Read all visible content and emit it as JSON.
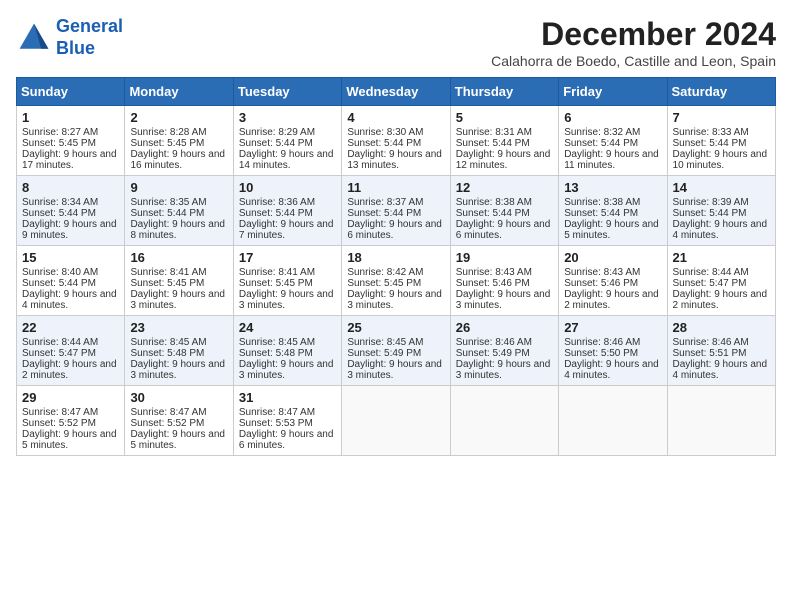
{
  "logo": {
    "line1": "General",
    "line2": "Blue"
  },
  "title": "December 2024",
  "subtitle": "Calahorra de Boedo, Castille and Leon, Spain",
  "days_of_week": [
    "Sunday",
    "Monday",
    "Tuesday",
    "Wednesday",
    "Thursday",
    "Friday",
    "Saturday"
  ],
  "weeks": [
    [
      {
        "day": "1",
        "sunrise": "Sunrise: 8:27 AM",
        "sunset": "Sunset: 5:45 PM",
        "daylight": "Daylight: 9 hours and 17 minutes."
      },
      {
        "day": "2",
        "sunrise": "Sunrise: 8:28 AM",
        "sunset": "Sunset: 5:45 PM",
        "daylight": "Daylight: 9 hours and 16 minutes."
      },
      {
        "day": "3",
        "sunrise": "Sunrise: 8:29 AM",
        "sunset": "Sunset: 5:44 PM",
        "daylight": "Daylight: 9 hours and 14 minutes."
      },
      {
        "day": "4",
        "sunrise": "Sunrise: 8:30 AM",
        "sunset": "Sunset: 5:44 PM",
        "daylight": "Daylight: 9 hours and 13 minutes."
      },
      {
        "day": "5",
        "sunrise": "Sunrise: 8:31 AM",
        "sunset": "Sunset: 5:44 PM",
        "daylight": "Daylight: 9 hours and 12 minutes."
      },
      {
        "day": "6",
        "sunrise": "Sunrise: 8:32 AM",
        "sunset": "Sunset: 5:44 PM",
        "daylight": "Daylight: 9 hours and 11 minutes."
      },
      {
        "day": "7",
        "sunrise": "Sunrise: 8:33 AM",
        "sunset": "Sunset: 5:44 PM",
        "daylight": "Daylight: 9 hours and 10 minutes."
      }
    ],
    [
      {
        "day": "8",
        "sunrise": "Sunrise: 8:34 AM",
        "sunset": "Sunset: 5:44 PM",
        "daylight": "Daylight: 9 hours and 9 minutes."
      },
      {
        "day": "9",
        "sunrise": "Sunrise: 8:35 AM",
        "sunset": "Sunset: 5:44 PM",
        "daylight": "Daylight: 9 hours and 8 minutes."
      },
      {
        "day": "10",
        "sunrise": "Sunrise: 8:36 AM",
        "sunset": "Sunset: 5:44 PM",
        "daylight": "Daylight: 9 hours and 7 minutes."
      },
      {
        "day": "11",
        "sunrise": "Sunrise: 8:37 AM",
        "sunset": "Sunset: 5:44 PM",
        "daylight": "Daylight: 9 hours and 6 minutes."
      },
      {
        "day": "12",
        "sunrise": "Sunrise: 8:38 AM",
        "sunset": "Sunset: 5:44 PM",
        "daylight": "Daylight: 9 hours and 6 minutes."
      },
      {
        "day": "13",
        "sunrise": "Sunrise: 8:38 AM",
        "sunset": "Sunset: 5:44 PM",
        "daylight": "Daylight: 9 hours and 5 minutes."
      },
      {
        "day": "14",
        "sunrise": "Sunrise: 8:39 AM",
        "sunset": "Sunset: 5:44 PM",
        "daylight": "Daylight: 9 hours and 4 minutes."
      }
    ],
    [
      {
        "day": "15",
        "sunrise": "Sunrise: 8:40 AM",
        "sunset": "Sunset: 5:44 PM",
        "daylight": "Daylight: 9 hours and 4 minutes."
      },
      {
        "day": "16",
        "sunrise": "Sunrise: 8:41 AM",
        "sunset": "Sunset: 5:45 PM",
        "daylight": "Daylight: 9 hours and 3 minutes."
      },
      {
        "day": "17",
        "sunrise": "Sunrise: 8:41 AM",
        "sunset": "Sunset: 5:45 PM",
        "daylight": "Daylight: 9 hours and 3 minutes."
      },
      {
        "day": "18",
        "sunrise": "Sunrise: 8:42 AM",
        "sunset": "Sunset: 5:45 PM",
        "daylight": "Daylight: 9 hours and 3 minutes."
      },
      {
        "day": "19",
        "sunrise": "Sunrise: 8:43 AM",
        "sunset": "Sunset: 5:46 PM",
        "daylight": "Daylight: 9 hours and 3 minutes."
      },
      {
        "day": "20",
        "sunrise": "Sunrise: 8:43 AM",
        "sunset": "Sunset: 5:46 PM",
        "daylight": "Daylight: 9 hours and 2 minutes."
      },
      {
        "day": "21",
        "sunrise": "Sunrise: 8:44 AM",
        "sunset": "Sunset: 5:47 PM",
        "daylight": "Daylight: 9 hours and 2 minutes."
      }
    ],
    [
      {
        "day": "22",
        "sunrise": "Sunrise: 8:44 AM",
        "sunset": "Sunset: 5:47 PM",
        "daylight": "Daylight: 9 hours and 2 minutes."
      },
      {
        "day": "23",
        "sunrise": "Sunrise: 8:45 AM",
        "sunset": "Sunset: 5:48 PM",
        "daylight": "Daylight: 9 hours and 3 minutes."
      },
      {
        "day": "24",
        "sunrise": "Sunrise: 8:45 AM",
        "sunset": "Sunset: 5:48 PM",
        "daylight": "Daylight: 9 hours and 3 minutes."
      },
      {
        "day": "25",
        "sunrise": "Sunrise: 8:45 AM",
        "sunset": "Sunset: 5:49 PM",
        "daylight": "Daylight: 9 hours and 3 minutes."
      },
      {
        "day": "26",
        "sunrise": "Sunrise: 8:46 AM",
        "sunset": "Sunset: 5:49 PM",
        "daylight": "Daylight: 9 hours and 3 minutes."
      },
      {
        "day": "27",
        "sunrise": "Sunrise: 8:46 AM",
        "sunset": "Sunset: 5:50 PM",
        "daylight": "Daylight: 9 hours and 4 minutes."
      },
      {
        "day": "28",
        "sunrise": "Sunrise: 8:46 AM",
        "sunset": "Sunset: 5:51 PM",
        "daylight": "Daylight: 9 hours and 4 minutes."
      }
    ],
    [
      {
        "day": "29",
        "sunrise": "Sunrise: 8:47 AM",
        "sunset": "Sunset: 5:52 PM",
        "daylight": "Daylight: 9 hours and 5 minutes."
      },
      {
        "day": "30",
        "sunrise": "Sunrise: 8:47 AM",
        "sunset": "Sunset: 5:52 PM",
        "daylight": "Daylight: 9 hours and 5 minutes."
      },
      {
        "day": "31",
        "sunrise": "Sunrise: 8:47 AM",
        "sunset": "Sunset: 5:53 PM",
        "daylight": "Daylight: 9 hours and 6 minutes."
      },
      null,
      null,
      null,
      null
    ]
  ]
}
